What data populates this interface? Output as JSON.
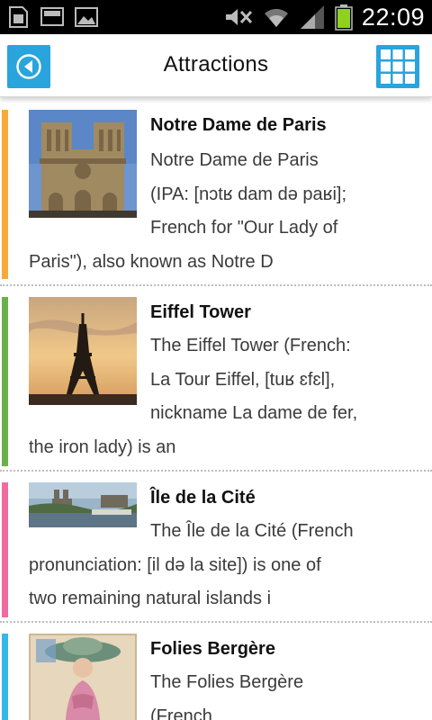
{
  "status_bar": {
    "time": "22:09",
    "icons": [
      "sim-card-icon",
      "screen-icon",
      "image-icon",
      "mute-icon",
      "wifi-icon",
      "signal-icon",
      "battery-icon"
    ]
  },
  "header": {
    "title": "Attractions",
    "back_icon": "back-arrow-icon",
    "grid_icon": "grid-view-icon",
    "accent": "#29a4dd"
  },
  "attractions": [
    {
      "title": "Notre Dame de Paris",
      "lines": [
        "Notre Dame de Paris",
        "(IPA: [nɔtʁ dam də paʁi];",
        "French for \"Our Lady of",
        "Paris\"), also known as Notre D"
      ],
      "color": "#f7a93a"
    },
    {
      "title": "Eiffel Tower",
      "lines": [
        "The Eiffel Tower (French:",
        "La Tour Eiffel, [tuʁ ɛfɛl],",
        "nickname La dame de fer,",
        "the iron lady) is an"
      ],
      "color": "#6ab04c"
    },
    {
      "title": "Île de la Cité",
      "lines": [
        "The Île de la Cité (French",
        "pronunciation: [il də la site]) is one of",
        "two remaining natural islands i"
      ],
      "color": "#f06ba0"
    },
    {
      "title": "Folies Bergère",
      "lines": [
        "The Folies Bergère",
        "(French"
      ],
      "color": "#34b8e8"
    }
  ]
}
